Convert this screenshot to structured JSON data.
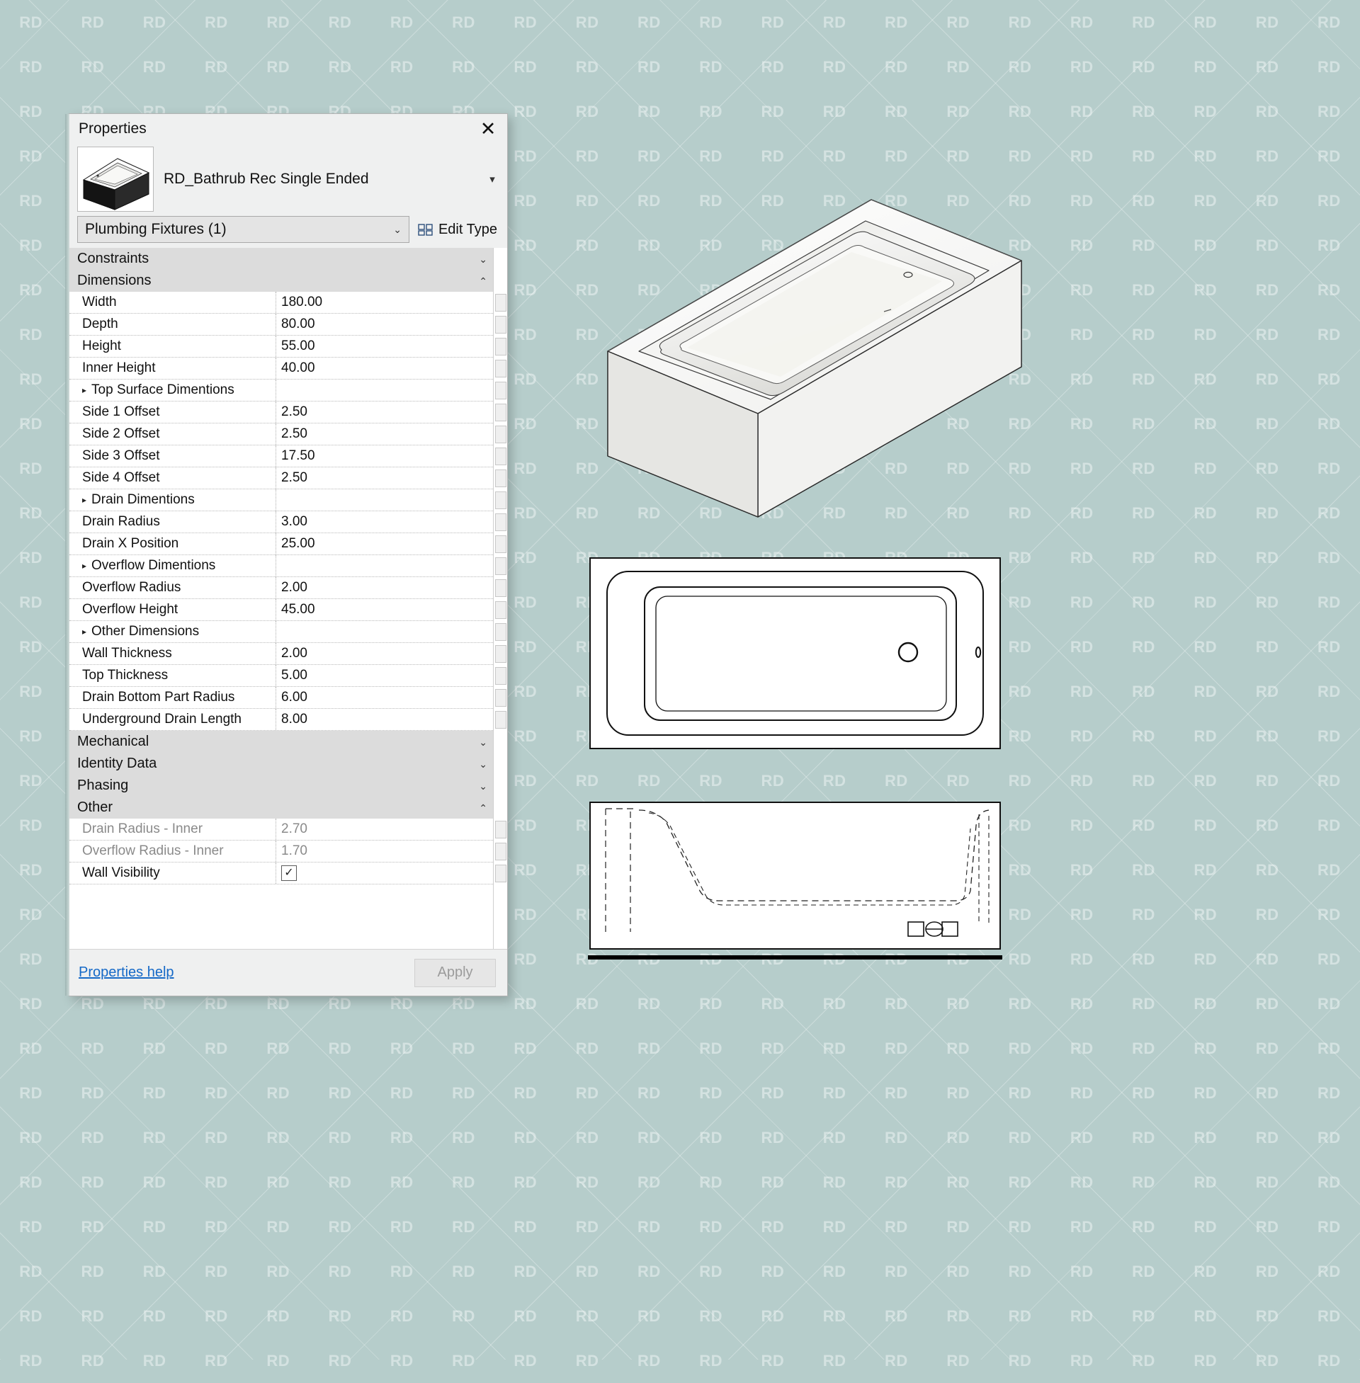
{
  "background": {
    "color": "#b6cdcb",
    "watermark_text": "RD"
  },
  "panel": {
    "title": "Properties",
    "close_icon": "✕",
    "type_name": "RD_Bathrub Rec Single Ended",
    "type_caret_icon": "▾",
    "thumbnail_icon": "bathtub-thumbnail",
    "selector_value": "Plumbing Fixtures (1)",
    "selector_caret_icon": "⌄",
    "edit_type_label": "Edit Type",
    "edit_type_icon": "edit-type-icon",
    "help_link": "Properties help",
    "apply_label": "Apply"
  },
  "groups": [
    {
      "name": "Constraints",
      "chevron": "⌄",
      "expanded": false
    },
    {
      "name": "Dimensions",
      "chevron": "⌃",
      "expanded": true
    },
    {
      "name": "Mechanical",
      "chevron": "⌄",
      "expanded": false
    },
    {
      "name": "Identity Data",
      "chevron": "⌄",
      "expanded": false
    },
    {
      "name": "Phasing",
      "chevron": "⌄",
      "expanded": false
    },
    {
      "name": "Other",
      "chevron": "⌃",
      "expanded": true
    }
  ],
  "dimension_rows": [
    {
      "label": "Width",
      "value": "180.00",
      "sub": false
    },
    {
      "label": "Depth",
      "value": "80.00",
      "sub": false
    },
    {
      "label": "Height",
      "value": "55.00",
      "sub": false
    },
    {
      "label": "Inner Height",
      "value": "40.00",
      "sub": false
    },
    {
      "label": "Top Surface Dimentions",
      "value": "",
      "sub": true
    },
    {
      "label": "Side 1 Offset",
      "value": "2.50",
      "sub": false
    },
    {
      "label": "Side 2 Offset",
      "value": "2.50",
      "sub": false
    },
    {
      "label": "Side 3 Offset",
      "value": "17.50",
      "sub": false
    },
    {
      "label": "Side 4 Offset",
      "value": "2.50",
      "sub": false
    },
    {
      "label": "Drain Dimentions",
      "value": "",
      "sub": true
    },
    {
      "label": "Drain Radius",
      "value": "3.00",
      "sub": false
    },
    {
      "label": "Drain X Position",
      "value": "25.00",
      "sub": false
    },
    {
      "label": "Overflow Dimentions",
      "value": "",
      "sub": true
    },
    {
      "label": "Overflow Radius",
      "value": "2.00",
      "sub": false
    },
    {
      "label": "Overflow Height",
      "value": "45.00",
      "sub": false
    },
    {
      "label": "Other Dimensions",
      "value": "",
      "sub": true
    },
    {
      "label": "Wall Thickness",
      "value": "2.00",
      "sub": false
    },
    {
      "label": "Top Thickness",
      "value": "5.00",
      "sub": false
    },
    {
      "label": "Drain Bottom Part Radius",
      "value": "6.00",
      "sub": false
    },
    {
      "label": "Underground Drain Length",
      "value": "8.00",
      "sub": false
    }
  ],
  "other_rows": [
    {
      "label": "Drain Radius - Inner",
      "value": "2.70",
      "readonly": true,
      "checkbox": false
    },
    {
      "label": "Overflow Radius - Inner",
      "value": "1.70",
      "readonly": true,
      "checkbox": false
    },
    {
      "label": "Wall Visibility",
      "value": "",
      "readonly": false,
      "checkbox": true,
      "checked": true,
      "check_icon": "✓"
    }
  ],
  "drawings": [
    {
      "name": "isometric-view",
      "icon": "bathtub-3d-isometric"
    },
    {
      "name": "plan-view",
      "icon": "bathtub-plan"
    },
    {
      "name": "elevation-view",
      "icon": "bathtub-elevation"
    }
  ]
}
